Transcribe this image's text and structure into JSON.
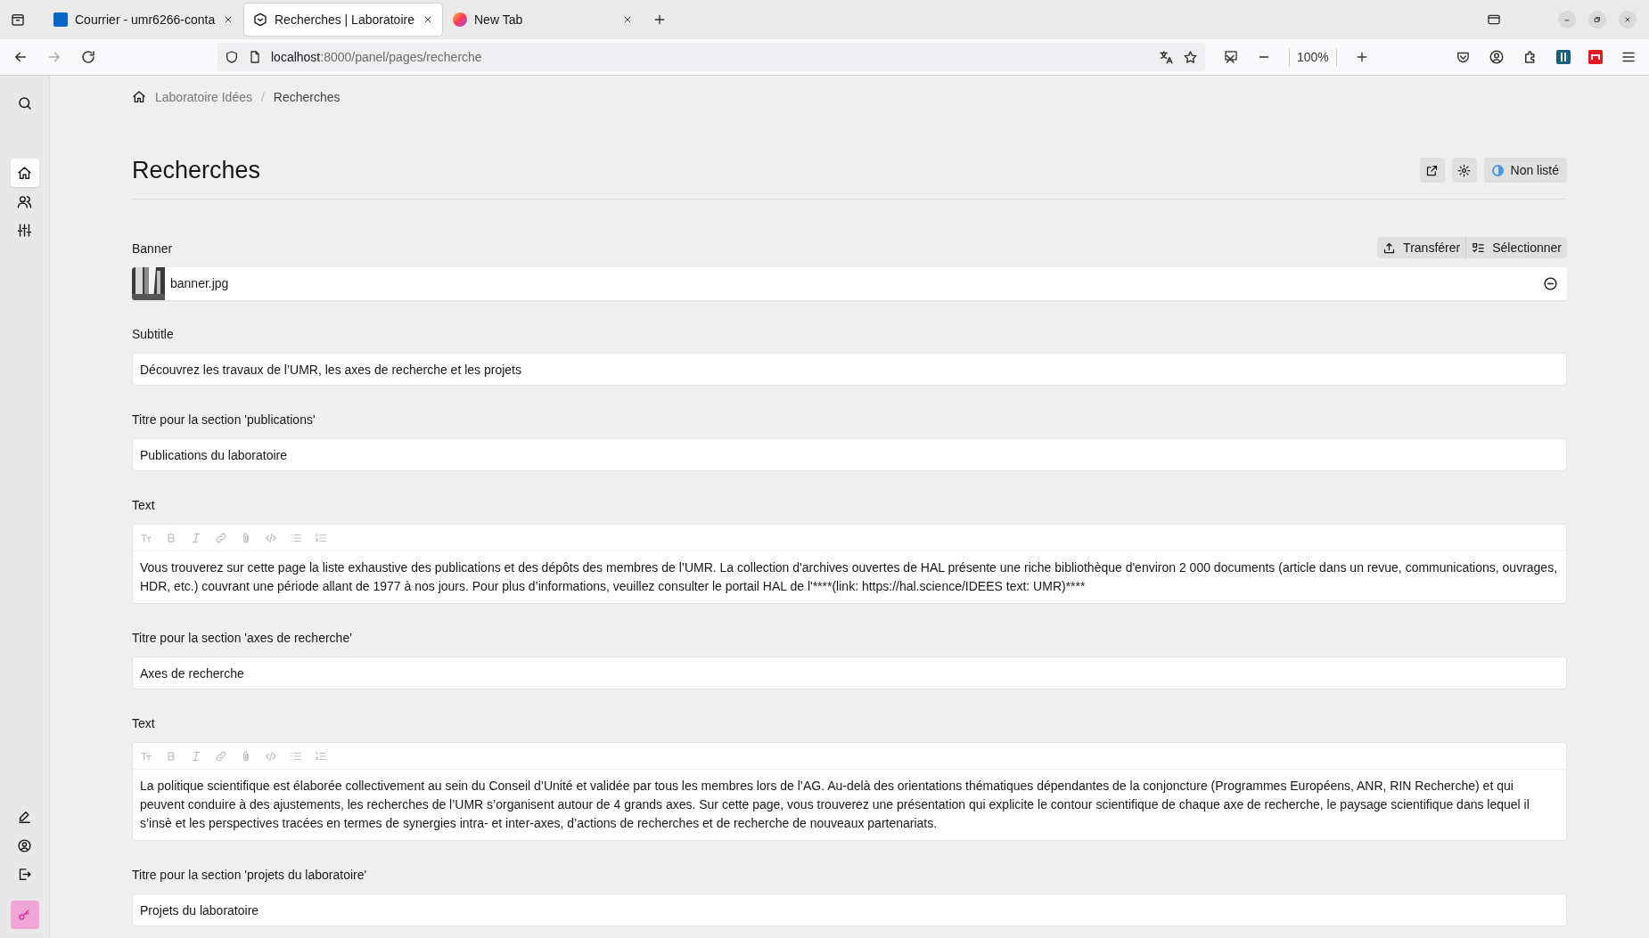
{
  "browser": {
    "tabs": [
      {
        "title": "Courrier - umr6266-conta",
        "selected": false
      },
      {
        "title": "Recherches | Laboratoire",
        "selected": true
      },
      {
        "title": "New Tab",
        "selected": false
      }
    ],
    "url_host": "localhost",
    "url_path": ":8000/panel/pages/recherche",
    "zoom": "100%"
  },
  "sidebar": {
    "top": [
      {
        "selected": true
      },
      {
        "selected": false
      },
      {
        "selected": false
      }
    ]
  },
  "breadcrumb": [
    "Laboratoire Idées",
    "Recherches"
  ],
  "breadcrumb_separator": "/",
  "page": {
    "title": "Recherches",
    "status": "Non listé"
  },
  "fields": [
    {
      "kind": "file",
      "label": "Banner",
      "value": "banner.jpg",
      "actions": [
        "Transférer",
        "Sélectionner"
      ]
    },
    {
      "kind": "input",
      "label": "Subtitle",
      "value": "Découvrez les travaux de l’UMR, les axes de recherche et les projets"
    },
    {
      "kind": "input",
      "label": "Titre pour la section 'publications'",
      "value": "Publications du laboratoire"
    },
    {
      "kind": "writer",
      "label": "Text",
      "value": "Vous trouverez sur cette page la liste exhaustive des publications et des dépôts des membres de l’UMR. La collection d'archives ouvertes de HAL présente une riche bibliothèque d'environ 2 000 documents (article dans un revue, communications, ouvrages, HDR, etc.) couvrant une période allant de 1977 à nos jours. Pour plus d’informations, veuillez consulter le portail HAL de l'****(link: https://hal.science/IDEES text: UMR)****"
    },
    {
      "kind": "input",
      "label": "Titre pour la section 'axes de recherche'",
      "value": "Axes de recherche"
    },
    {
      "kind": "writer",
      "label": "Text",
      "value": "La politique scientifique est élaborée collectivement au sein du Conseil d’Unité et validée par tous les membres lors de l’AG. Au-delà des orientations thématiques dépendantes de la conjoncture (Programmes Européens, ANR, RIN Recherche) et qui peuvent conduire à des ajustements, les recherches de l’UMR s’organisent autour de 4 grands axes. Sur cette page, vous trouverez une présentation qui explicite le contour scientifique de chaque axe de recherche, le paysage scientifique dans lequel il s’insè et les perspectives tracées en termes de synergies intra- et inter-axes, d’actions de recherches et de recherche de nouveaux partenariats."
    },
    {
      "kind": "input",
      "label": "Titre pour la section 'projets du laboratoire'",
      "value": "Projets du laboratoire"
    }
  ]
}
